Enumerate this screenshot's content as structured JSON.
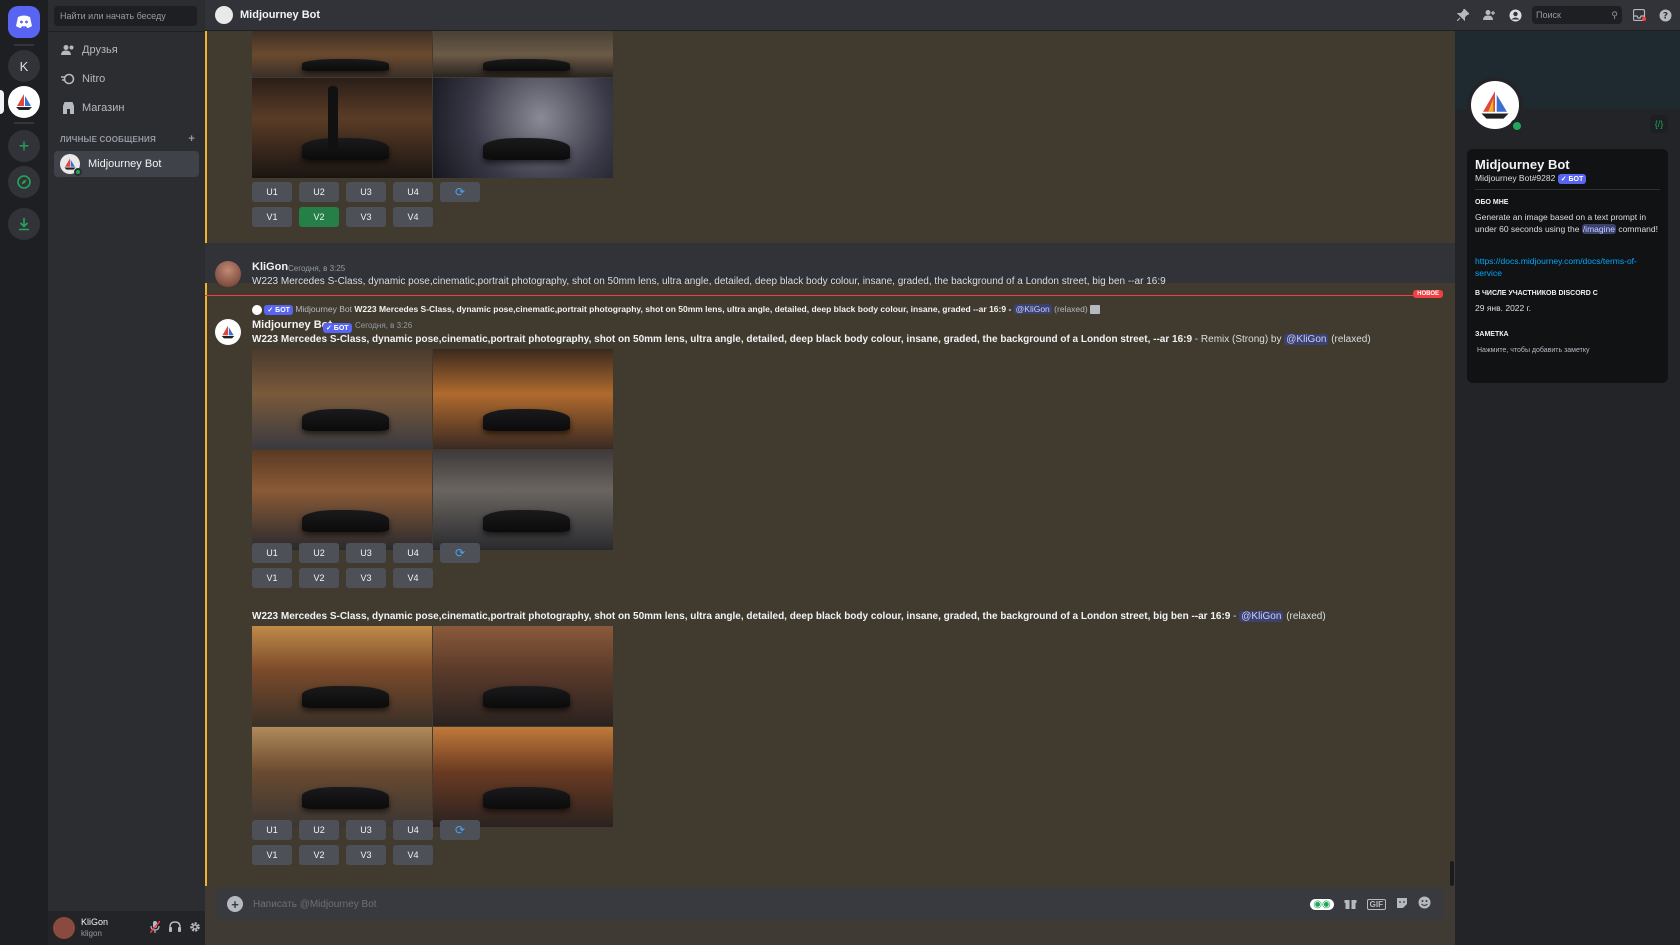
{
  "rail": {
    "server_letter": "K"
  },
  "sidebar": {
    "search_placeholder": "Найти или начать беседу",
    "nav": [
      {
        "label": "Друзья",
        "icon": "friends-icon"
      },
      {
        "label": "Nitro",
        "icon": "nitro-icon"
      },
      {
        "label": "Магазин",
        "icon": "shop-icon"
      }
    ],
    "dm_header": "ЛИЧНЫЕ СООБЩЕНИЯ",
    "dm_add": "+",
    "dm_items": [
      {
        "label": "Midjourney Bot"
      }
    ]
  },
  "user_panel": {
    "name": "KliGon",
    "tag": "kligon"
  },
  "topbar": {
    "title": "Midjourney Bot",
    "search_placeholder": "Поиск"
  },
  "buttons": {
    "upscale": [
      "U1",
      "U2",
      "U3",
      "U4"
    ],
    "variation": [
      "V1",
      "V2",
      "V3",
      "V4"
    ]
  },
  "messages": {
    "user": {
      "name": "KliGon",
      "time": "Сегодня, в 3:25",
      "text": "W223 Mercedes S-Class, dynamic pose,cinematic,portrait photography, shot on 50mm lens, ultra angle, detailed, deep black body colour, insane, graded, the background of a London street, big ben  --ar 16:9"
    },
    "new_label": "НОВОЕ",
    "reply": {
      "badge": "✓ БОТ",
      "name": "Midjourney Bot",
      "text": "W223 Mercedes S-Class, dynamic pose,cinematic,portrait photography, shot on 50mm lens, ultra angle, detailed, deep black body colour, insane, graded --ar 16:9 - ",
      "mention": "@KliGon",
      "suffix": "(relaxed)"
    },
    "bot": {
      "name": "Midjourney Bot",
      "badge": "✓ БОТ",
      "time": "Сегодня, в 3:26",
      "prompt1_bold": "W223 Mercedes S-Class, dynamic pose,cinematic,portrait photography, shot on 50mm lens, ultra angle, detailed, deep black body colour, insane, graded, the background of a London street, --ar 16:9",
      "prompt1_rest": " - Remix (Strong) by ",
      "prompt1_mention": "@KliGon",
      "prompt1_suffix": " (relaxed)",
      "prompt2_bold": "W223 Mercedes S-Class, dynamic pose,cinematic,portrait photography, shot on 50mm lens, ultra angle, detailed, deep black body colour, insane, graded, the background of a London street, big ben --ar 16:9",
      "prompt2_rest": " - ",
      "prompt2_mention": "@KliGon",
      "prompt2_suffix": " (relaxed)"
    }
  },
  "composer": {
    "placeholder": "Написать @Midjourney Bot"
  },
  "profile": {
    "name": "Midjourney Bot",
    "tag": "Midjourney Bot#9282",
    "badge": "✓ БОТ",
    "about_head": "ОБО МНЕ",
    "about_text_1": "Generate an image based on a text prompt in under 60 seconds using the ",
    "about_cmd": "/imagine",
    "about_text_2": " command!",
    "link": "https://docs.midjourney.com/docs/terms-of-service",
    "member_head": "В ЧИСЛЕ УЧАСТНИКОВ DISCORD С",
    "member_date": "29 янв. 2022 г.",
    "note_head": "ЗАМЕТКА",
    "note_placeholder": "Нажмите, чтобы добавить заметку"
  },
  "colors": {
    "accent": "#5865f2",
    "online": "#23a55a",
    "new": "#f23f43",
    "mention_bar": "#f0b232",
    "active_button": "#248046"
  }
}
